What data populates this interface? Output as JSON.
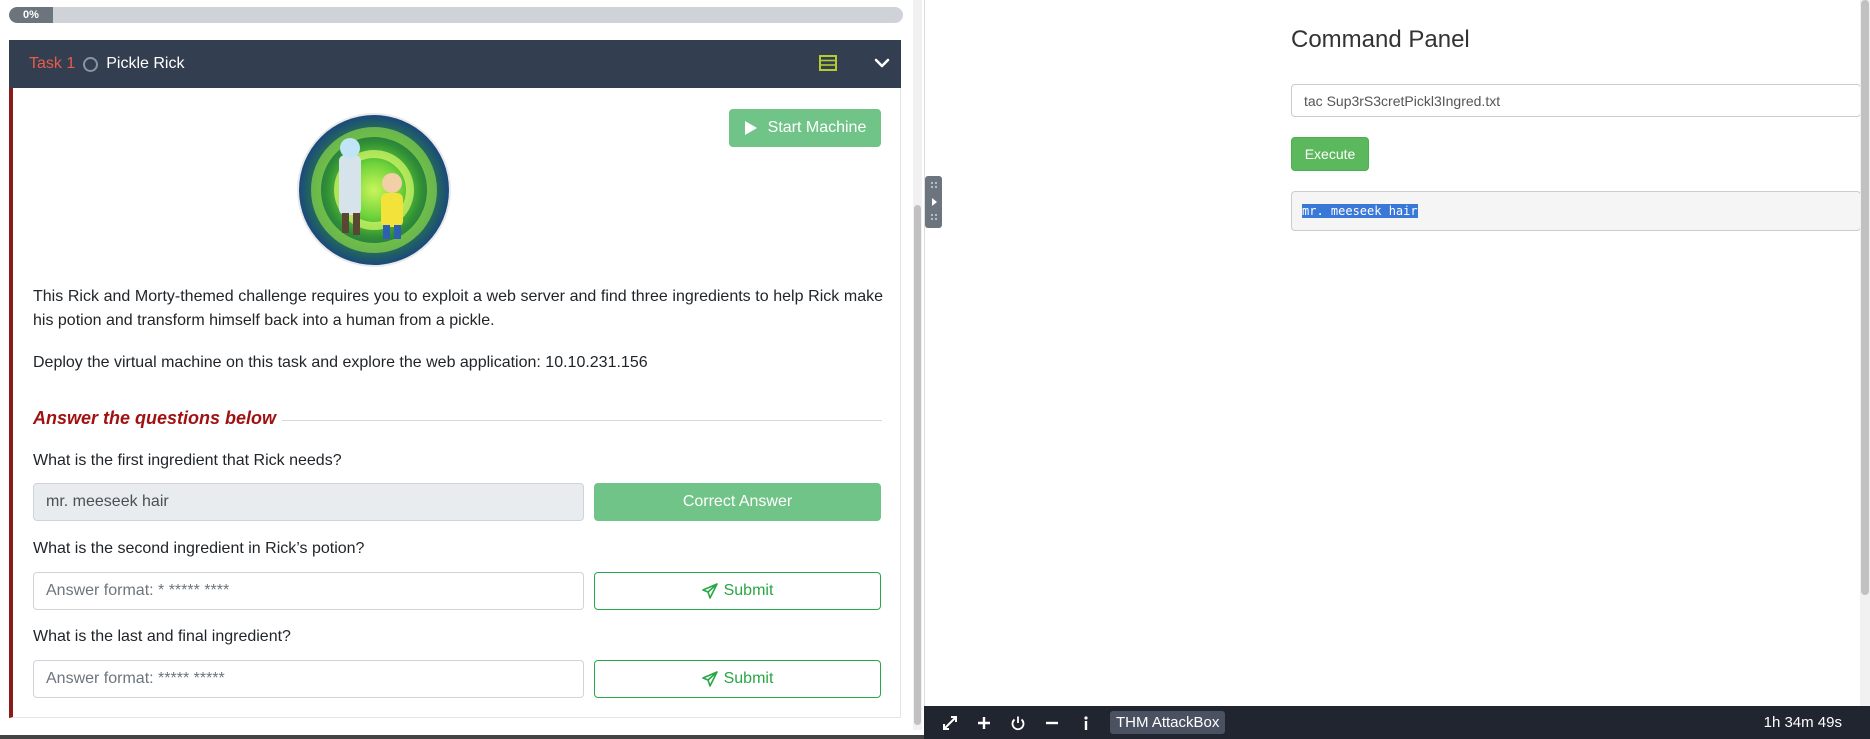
{
  "progress": {
    "label": "0%",
    "value": 0
  },
  "task": {
    "number": "Task 1",
    "title": "Pickle Rick",
    "start_machine_label": "Start Machine",
    "description_1": "This Rick and Morty-themed challenge requires you to exploit a web server and find three ingredients to help Rick make his potion and transform himself back into a human from a pickle.",
    "description_2": "Deploy the virtual machine on this task and explore the web application: 10.10.231.156",
    "questions_heading": "Answer the questions below",
    "questions": [
      {
        "label": "What is the first ingredient that Rick needs?",
        "value": "mr. meeseek hair",
        "placeholder": "",
        "button": "Correct Answer"
      },
      {
        "label": "What is the second ingredient in Rick’s potion?",
        "value": "",
        "placeholder": "Answer format: * ***** ****",
        "button": "Submit"
      },
      {
        "label": "What is the last and final ingredient?",
        "value": "",
        "placeholder": "Answer format: ***** *****",
        "button": "Submit"
      }
    ]
  },
  "command_panel": {
    "title": "Command Panel",
    "input_value": "tac Sup3rS3cretPickl3Ingred.txt",
    "execute_label": "Execute",
    "output": "mr. meeseek hair"
  },
  "toolbar": {
    "icons": [
      "fullscreen-icon",
      "plus-icon",
      "power-icon",
      "minus-icon",
      "info-icon"
    ],
    "attackbox_label": "THM AttackBox",
    "timer": "1h 34m 49s"
  },
  "colors": {
    "header_bg": "#343e51",
    "task_number": "#e85c4a",
    "accent_green": "#71c487",
    "heading_red": "#a01212",
    "execute_green": "#5cb85c"
  }
}
